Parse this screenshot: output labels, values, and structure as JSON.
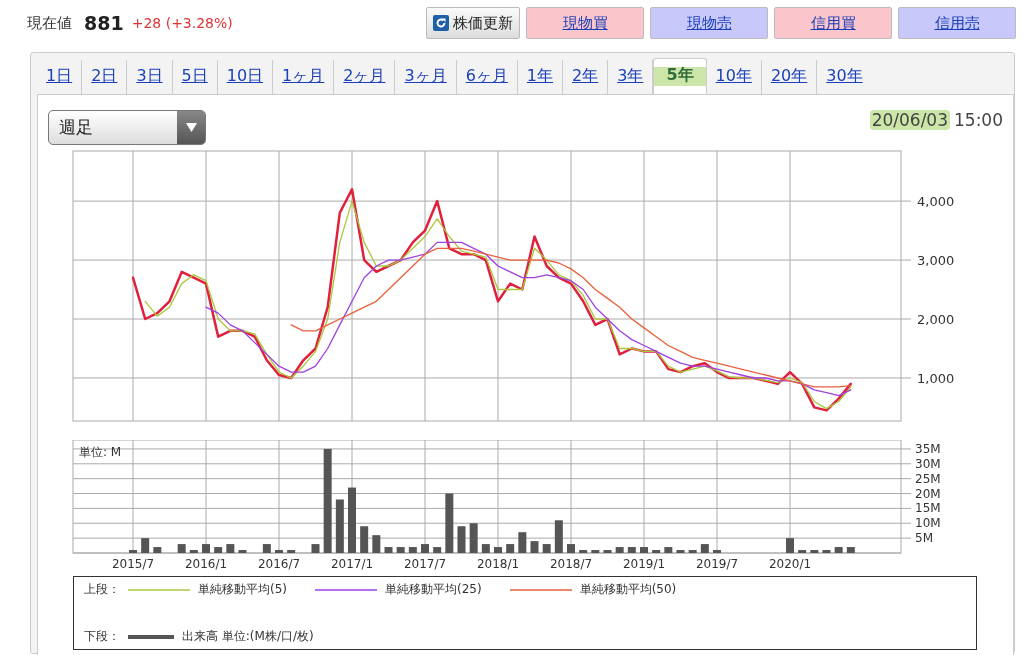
{
  "quote": {
    "label": "現在値",
    "price": "881",
    "change": "+28 (+3.28%)"
  },
  "buttons": [
    {
      "label": "株価更新",
      "kind": "refresh"
    },
    {
      "label": "現物買",
      "kind": "buy"
    },
    {
      "label": "現物売",
      "kind": "sell"
    },
    {
      "label": "信用買",
      "kind": "buy"
    },
    {
      "label": "信用売",
      "kind": "sell"
    }
  ],
  "tabs": [
    {
      "label": "1日",
      "selected": false
    },
    {
      "label": "2日",
      "selected": false
    },
    {
      "label": "3日",
      "selected": false
    },
    {
      "label": "5日",
      "selected": false
    },
    {
      "label": "10日",
      "selected": false
    },
    {
      "label": "1ヶ月",
      "selected": false
    },
    {
      "label": "2ヶ月",
      "selected": false
    },
    {
      "label": "3ヶ月",
      "selected": false
    },
    {
      "label": "6ヶ月",
      "selected": false
    },
    {
      "label": "1年",
      "selected": false
    },
    {
      "label": "2年",
      "selected": false
    },
    {
      "label": "3年",
      "selected": false
    },
    {
      "label": "5年",
      "selected": true
    },
    {
      "label": "10年",
      "selected": false
    },
    {
      "label": "20年",
      "selected": false
    },
    {
      "label": "30年",
      "selected": false
    }
  ],
  "chart_panel": {
    "interval": "週足",
    "date": "20/06/03",
    "date_highlighted": true,
    "time": "15:00",
    "price_chart": {
      "chart_data": {
        "type": "line",
        "grid": true,
        "ylim": [
          270,
          4850
        ],
        "categories": [
          null,
          null,
          null,
          null,
          null,
          null,
          null,
          null,
          null,
          null,
          null,
          null,
          null,
          null,
          null,
          null,
          null,
          null,
          null,
          null,
          null,
          null,
          null,
          null,
          null,
          null,
          null,
          null,
          null,
          null,
          null,
          null,
          null,
          null,
          null,
          null,
          null,
          null,
          null,
          null,
          null,
          null,
          null,
          null,
          null,
          null,
          null,
          null,
          null,
          null,
          null,
          null,
          null,
          null,
          null,
          null,
          null,
          null,
          null,
          null
        ],
        "yticks": [
          {
            "value": 1000,
            "label": "1,000"
          },
          {
            "value": 2000,
            "label": "2,000"
          },
          {
            "value": 3000,
            "label": "3,000"
          },
          {
            "value": 4000,
            "label": "4,000"
          }
        ],
        "series": [
          {
            "color": "#e0203c",
            "values": [
              2700,
              2000,
              2100,
              2300,
              2800,
              2700,
              2600,
              1700,
              1800,
              1800,
              1700,
              1300,
              1050,
              1000,
              1300,
              1500,
              2200,
              3800,
              4200,
              3000,
              2800,
              2900,
              3000,
              3300,
              3500,
              4000,
              3200,
              3100,
              3100,
              3000,
              2300,
              2600,
              2500,
              3400,
              2900,
              2700,
              2600,
              2300,
              1900,
              2000,
              1400,
              1500,
              1450,
              1450,
              1150,
              1100,
              1200,
              1250,
              1100,
              1000,
              1000,
              1000,
              950,
              900,
              1100,
              900,
              500,
              450,
              650,
              900
            ]
          },
          {
            "name": "単純移動平均(5)",
            "color": "#a8c83c",
            "values": [
              null,
              2300,
              2050,
              2200,
              2600,
              2750,
              2650,
              2000,
              1800,
              1800,
              1750,
              1400,
              1100,
              1000,
              1200,
              1450,
              2000,
              3300,
              4000,
              3300,
              2900,
              2900,
              3000,
              3200,
              3400,
              3700,
              3400,
              3150,
              3100,
              3050,
              2500,
              2500,
              2500,
              3200,
              3000,
              2750,
              2650,
              2400,
              2000,
              2000,
              1500,
              1500,
              1450,
              1450,
              1200,
              1100,
              1150,
              1200,
              1120,
              1020,
              1000,
              1000,
              960,
              920,
              1000,
              920,
              600,
              480,
              600,
              850
            ]
          },
          {
            "name": "単純移動平均(25)",
            "color": "#a040e0",
            "values": [
              null,
              null,
              null,
              null,
              null,
              null,
              2200,
              2100,
              1900,
              1800,
              1600,
              1400,
              1200,
              1100,
              1100,
              1200,
              1500,
              1900,
              2300,
              2700,
              2900,
              3000,
              3000,
              3050,
              3100,
              3300,
              3300,
              3300,
              3200,
              3100,
              2900,
              2800,
              2700,
              2700,
              2750,
              2700,
              2650,
              2500,
              2200,
              2000,
              1800,
              1650,
              1550,
              1450,
              1350,
              1250,
              1200,
              1200,
              1150,
              1100,
              1050,
              1000,
              1000,
              950,
              950,
              900,
              800,
              750,
              700,
              800
            ]
          },
          {
            "name": "単純移動平均(50)",
            "color": "#e8603c",
            "values": [
              null,
              null,
              null,
              null,
              null,
              null,
              null,
              null,
              null,
              null,
              null,
              null,
              null,
              1900,
              1800,
              1800,
              1900,
              2000,
              2100,
              2200,
              2300,
              2500,
              2700,
              2900,
              3100,
              3200,
              3200,
              3200,
              3150,
              3100,
              3050,
              3000,
              3000,
              3000,
              3000,
              2950,
              2850,
              2700,
              2500,
              2350,
              2200,
              2000,
              1850,
              1700,
              1550,
              1450,
              1350,
              1300,
              1250,
              1200,
              1150,
              1100,
              1050,
              1000,
              950,
              900,
              850,
              850,
              850,
              870
            ]
          }
        ]
      }
    },
    "volume_chart": {
      "chart_data": {
        "type": "bar",
        "grid": true,
        "ylabel": "単位: M",
        "ylim": [
          0,
          38
        ],
        "categories": [
          "2015/7",
          null,
          null,
          null,
          null,
          null,
          "2016/1",
          null,
          null,
          null,
          null,
          null,
          "2016/7",
          null,
          null,
          null,
          null,
          null,
          "2017/1",
          null,
          null,
          null,
          null,
          null,
          "2017/7",
          null,
          null,
          null,
          null,
          null,
          "2018/1",
          null,
          null,
          null,
          null,
          null,
          "2018/7",
          null,
          null,
          null,
          null,
          null,
          "2019/1",
          null,
          null,
          null,
          null,
          null,
          "2019/7",
          null,
          null,
          null,
          null,
          null,
          "2020/1",
          null,
          null,
          null,
          null,
          null
        ],
        "yticks": [
          {
            "value": 5,
            "label": "5M"
          },
          {
            "value": 10,
            "label": "10M"
          },
          {
            "value": 15,
            "label": "15M"
          },
          {
            "value": 20,
            "label": "20M"
          },
          {
            "value": 25,
            "label": "25M"
          },
          {
            "value": 30,
            "label": "30M"
          },
          {
            "value": 35,
            "label": "35M"
          }
        ],
        "series": [
          {
            "name": "出来高 単位:(M株/口/枚)",
            "color": "#555555",
            "values": [
              1,
              5,
              2,
              0,
              3,
              1,
              3,
              2,
              3,
              1,
              0,
              3,
              1,
              1,
              0,
              3,
              35,
              18,
              22,
              9,
              6,
              2,
              2,
              2,
              3,
              2,
              20,
              9,
              10,
              3,
              2,
              3,
              7,
              4,
              3,
              11,
              3,
              1,
              1,
              1,
              2,
              2,
              2,
              1,
              2,
              1,
              1,
              3,
              1,
              0,
              0,
              0,
              0,
              0,
              5,
              1,
              1,
              1,
              2,
              2
            ]
          }
        ]
      }
    },
    "legend": {
      "upper_label": "上段：",
      "lower_label": "下段："
    }
  }
}
